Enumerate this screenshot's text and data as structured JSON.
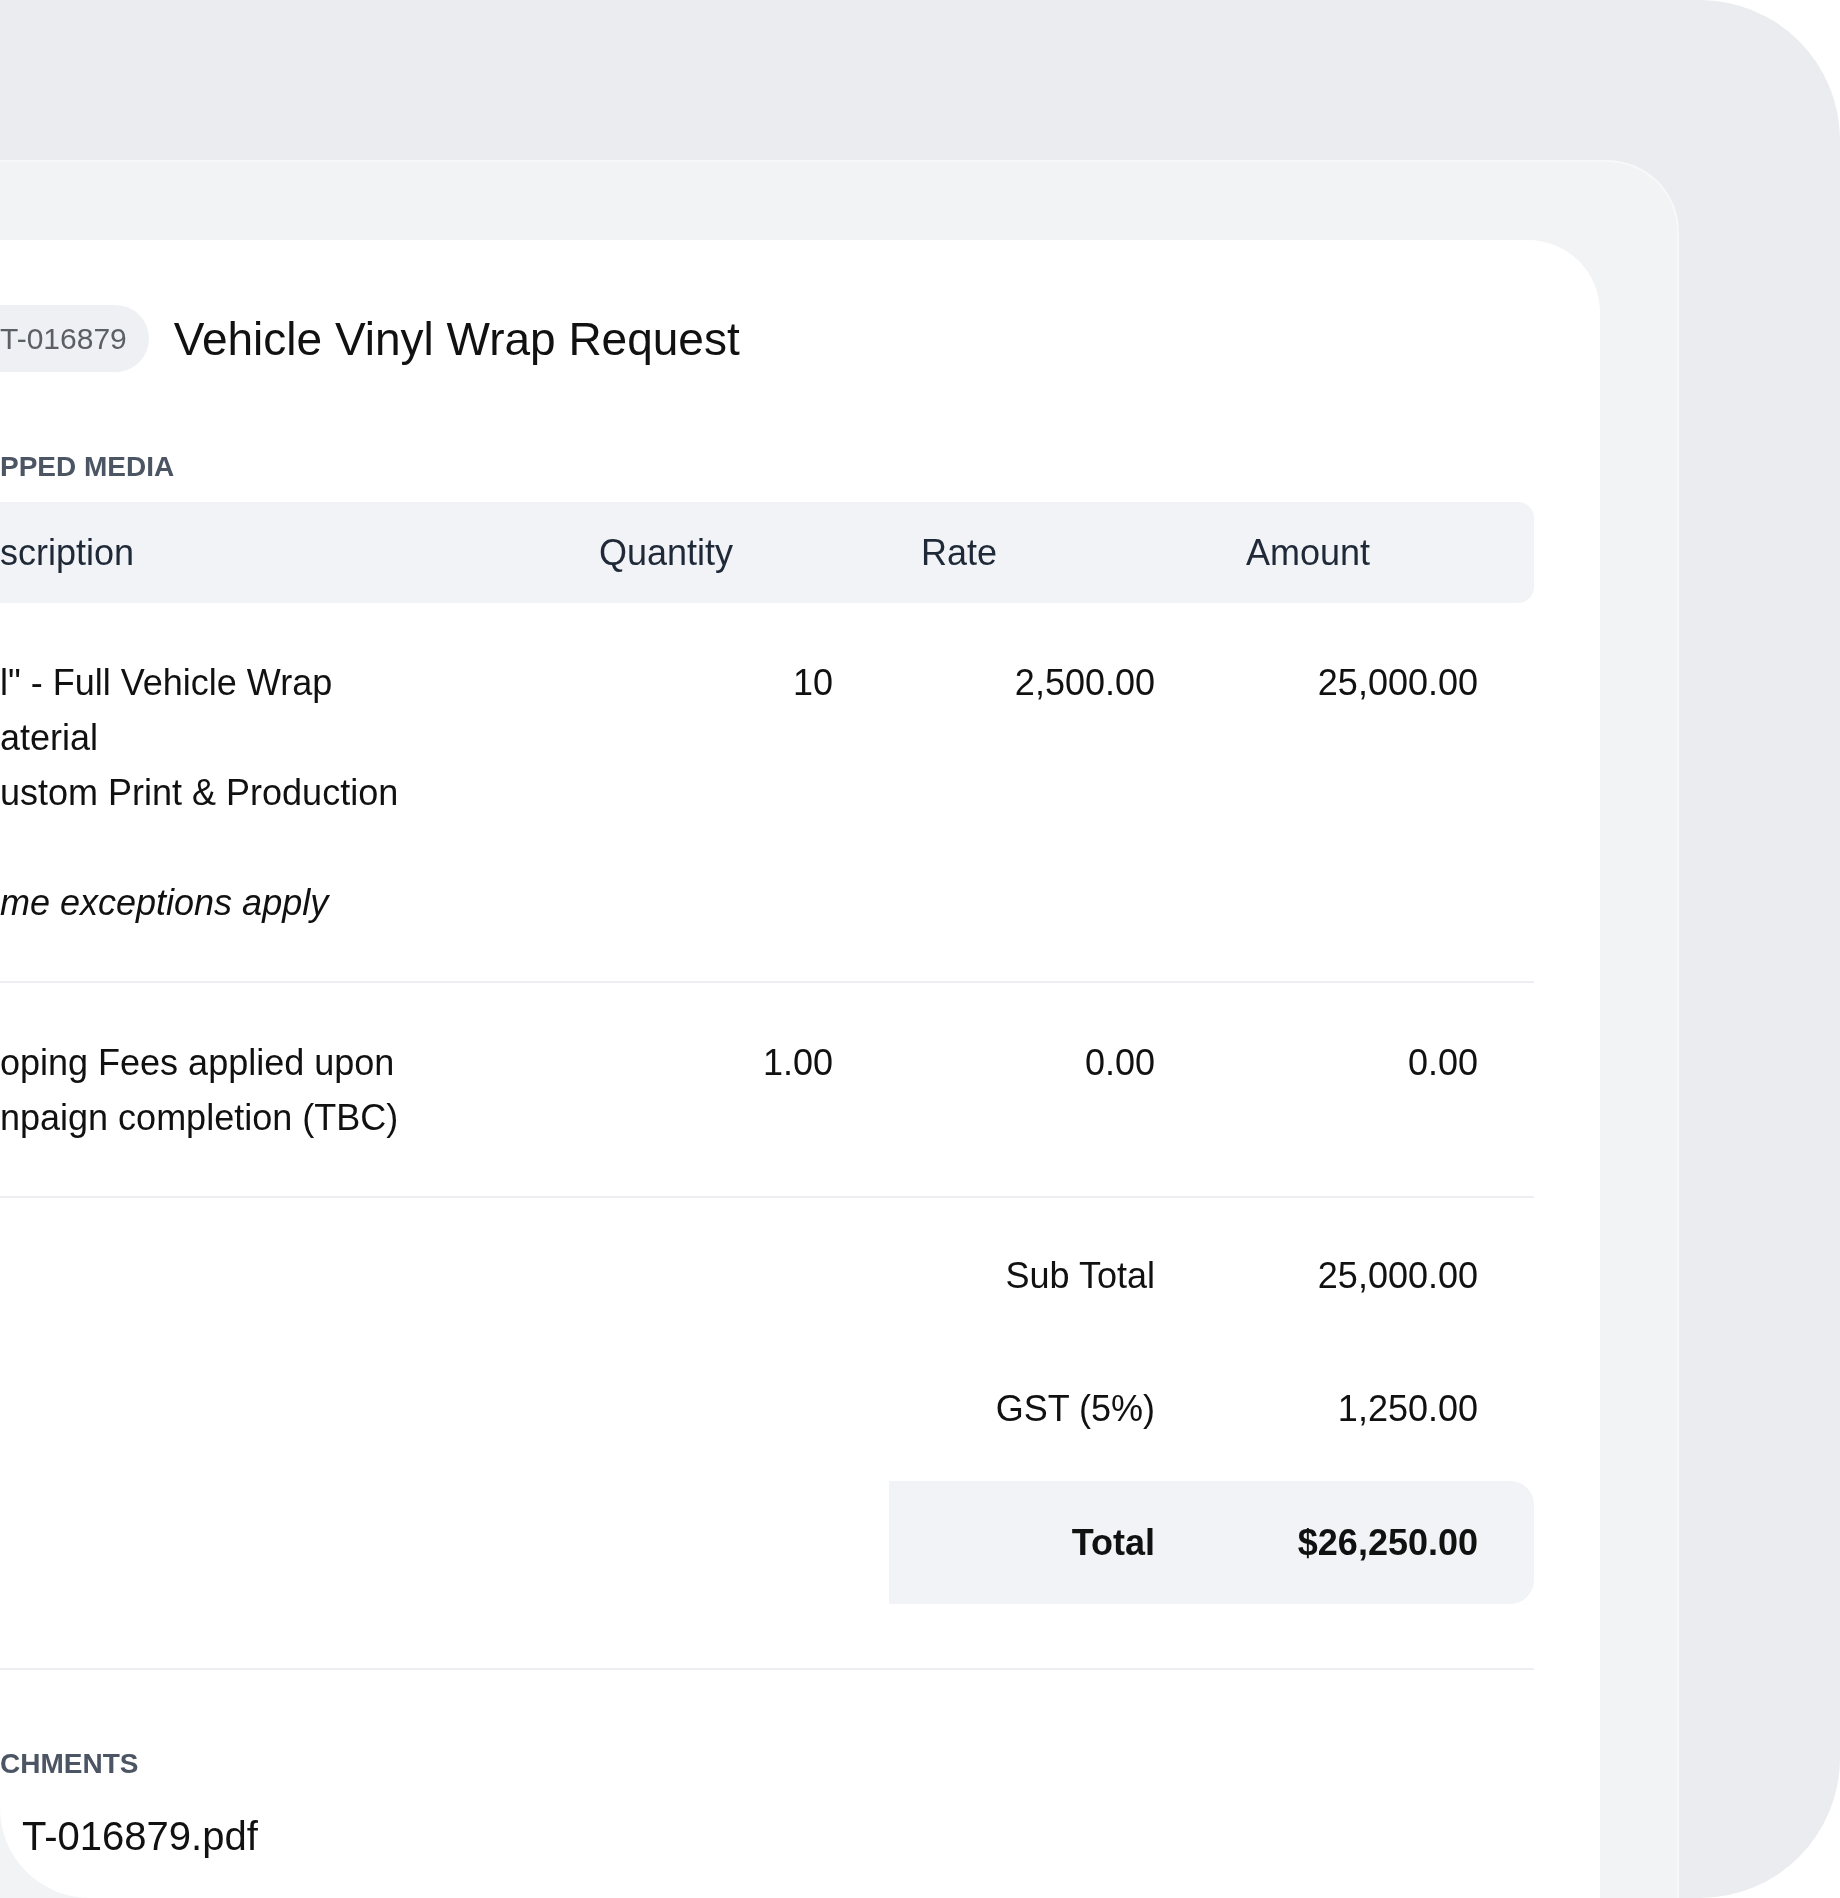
{
  "request": {
    "id_badge": "T-016879",
    "title": "Vehicle Vinyl Wrap Request"
  },
  "media": {
    "section_label": "PPED MEDIA",
    "columns": [
      "scription",
      "Quantity",
      "Rate",
      "Amount"
    ],
    "rows": [
      {
        "description": [
          "l\" - Full Vehicle Wrap",
          "aterial",
          "ustom Print & Production"
        ],
        "note": "me exceptions apply",
        "quantity": "10",
        "rate": "2,500.00",
        "amount": "25,000.00"
      },
      {
        "description": [
          "oping Fees applied upon",
          "npaign completion (TBC)"
        ],
        "quantity": "1.00",
        "rate": "0.00",
        "amount": "0.00"
      }
    ],
    "totals": [
      {
        "label": "Sub Total",
        "value": "25,000.00",
        "kind": "line"
      },
      {
        "label": "GST (5%)",
        "value": "1,250.00",
        "kind": "line"
      },
      {
        "label": "Total",
        "value": "$26,250.00",
        "kind": "grand"
      }
    ]
  },
  "attachments": {
    "section_label": "CHMENTS",
    "files": [
      "T-016879.pdf"
    ]
  }
}
